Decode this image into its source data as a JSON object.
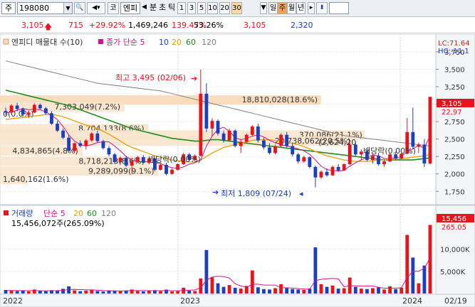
{
  "toolbar": {
    "market_label": "주",
    "code_value": "198080",
    "button_co": "코",
    "stock_name": "엔피",
    "label_split": "분",
    "label_tick": "초",
    "label_tik": "틱",
    "interval_buttons": [
      "1",
      "3",
      "5",
      "10",
      "20",
      "30"
    ],
    "interval_selected": "30",
    "label_day": "일",
    "label_week": "주",
    "label_month": "월",
    "label_year": "년"
  },
  "info_row": {
    "price": "3,105",
    "change": "715",
    "change_pct": "+29.92%",
    "volume": "1,469,246",
    "volume_ratio": "139.47%",
    "turnover_pct": "53.26%",
    "price_2": "3,105",
    "price_3": "2,320"
  },
  "price_panel": {
    "legend_volume_profile": "엔피디 매물대 수(10)",
    "legend_ma_label": "종가 단순 5",
    "ma_periods": [
      "10",
      "20",
      "60",
      "120"
    ],
    "ma_colors": {
      "5": "#d0128a",
      "10": "#1e44c8",
      "20": "#e8a000",
      "60": "#1c8f1c",
      "120": "#808080"
    },
    "lc_label": "LC:71.64",
    "hc_label": "HC:-11.1",
    "current_price_tag": "3,105",
    "right_tag_2": "22,97",
    "annot_high": "최고 3,495 (02/06)",
    "annot_low": "최저 1,809 (07/24)",
    "annot_dividend_1": "배당락(0.00%)",
    "annot_dividend_2": "배당락(0.00%)"
  },
  "volume_panel": {
    "legend_label": "거래량",
    "legend_ma": "단순 5",
    "ma_periods": [
      "20",
      "60",
      "120"
    ],
    "vol_readout": "15,456,072주(265.09%)",
    "right_tag_vol": "15,456",
    "right_tag_pct": "265.05"
  },
  "x_axis": {
    "labels": [
      "2022",
      "2023",
      "2024",
      "02/19"
    ]
  },
  "chart_data": {
    "type": "candlestick",
    "price_axis": {
      "ticks": [
        "3,750",
        "3,500",
        "3,250",
        "3,000",
        "2,750",
        "2,500",
        "2,250",
        "2,000",
        "1,750"
      ],
      "range": [
        1600,
        3780
      ]
    },
    "volume_axis": {
      "ticks": [
        "10,000K",
        "5,000K"
      ],
      "range": [
        0,
        16500
      ]
    },
    "volume_profile": [
      {
        "price": 3060,
        "label": "18,810,028(18.6%)",
        "value": 18810028
      },
      {
        "price": 2960,
        "label": "7,303,049(7.2%)",
        "value": 7303049
      },
      {
        "price": 2860,
        "label": "0(0.0%)",
        "value": 0
      },
      {
        "price": 2650,
        "label": "8,704,133(8.6%)",
        "value": 8704133
      },
      {
        "price": 2560,
        "label": "370,086(21.1%)",
        "value": 21370086
      },
      {
        "price": 2470,
        "label": "20,738,062(20.5%)",
        "value": 20738062
      },
      {
        "price": 2330,
        "label": "4,834,865(4.8%)",
        "value": 4834865
      },
      {
        "price": 2180,
        "label": "8,718,213(8.6%)",
        "value": 8718213
      },
      {
        "price": 2040,
        "label": "9,289,099(9.1%)",
        "value": 9289099
      },
      {
        "price": 1920,
        "label": "1,640,162(1.6%)",
        "value": 1640162
      }
    ],
    "annotation_extra": "(2,624,20",
    "candles": [
      [
        2900,
        2950,
        2840,
        2880
      ],
      [
        2880,
        3000,
        2860,
        2980
      ],
      [
        2980,
        3020,
        2900,
        2930
      ],
      [
        2930,
        2950,
        2820,
        2850
      ],
      [
        2850,
        2900,
        2800,
        2880
      ],
      [
        2880,
        3010,
        2870,
        2990
      ],
      [
        2990,
        3010,
        2920,
        2940
      ],
      [
        2940,
        2960,
        2850,
        2870
      ],
      [
        2870,
        2900,
        2700,
        2720
      ],
      [
        2720,
        2760,
        2600,
        2620
      ],
      [
        2620,
        2650,
        2500,
        2520
      ],
      [
        2520,
        2560,
        2300,
        2330
      ],
      [
        2330,
        2450,
        2320,
        2440
      ],
      [
        2440,
        2480,
        2380,
        2400
      ],
      [
        2400,
        2500,
        2350,
        2480
      ],
      [
        2480,
        2600,
        2460,
        2580
      ],
      [
        2580,
        2620,
        2450,
        2470
      ],
      [
        2470,
        2490,
        2350,
        2370
      ],
      [
        2370,
        2400,
        2250,
        2280
      ],
      [
        2280,
        2300,
        2150,
        2170
      ],
      [
        2170,
        2250,
        2150,
        2230
      ],
      [
        2230,
        2260,
        2100,
        2120
      ],
      [
        2120,
        2200,
        2000,
        2180
      ],
      [
        2180,
        2260,
        2160,
        2240
      ],
      [
        2240,
        2270,
        2150,
        2160
      ],
      [
        2160,
        2240,
        2140,
        2220
      ],
      [
        2220,
        2230,
        2040,
        2060
      ],
      [
        2060,
        2150,
        2050,
        2130
      ],
      [
        2130,
        2160,
        1980,
        2000
      ],
      [
        2000,
        2080,
        1990,
        2060
      ],
      [
        2060,
        2150,
        2050,
        2140
      ],
      [
        2140,
        2300,
        2130,
        2280
      ],
      [
        2280,
        2300,
        2180,
        2200
      ],
      [
        2200,
        2280,
        2190,
        2260
      ],
      [
        2260,
        3495,
        2250,
        3150
      ],
      [
        3150,
        3300,
        2600,
        2650
      ],
      [
        2650,
        2800,
        2550,
        2760
      ],
      [
        2760,
        2780,
        2550,
        2580
      ],
      [
        2580,
        2620,
        2450,
        2480
      ],
      [
        2480,
        2650,
        2470,
        2620
      ],
      [
        2620,
        2640,
        2380,
        2400
      ],
      [
        2400,
        2500,
        2300,
        2460
      ],
      [
        2460,
        2580,
        2440,
        2560
      ],
      [
        2560,
        2700,
        2540,
        2680
      ],
      [
        2680,
        2720,
        2450,
        2480
      ],
      [
        2480,
        2520,
        2350,
        2380
      ],
      [
        2380,
        2440,
        2280,
        2300
      ],
      [
        2300,
        2420,
        2280,
        2400
      ],
      [
        2400,
        2580,
        2390,
        2560
      ],
      [
        2560,
        2600,
        2380,
        2400
      ],
      [
        2400,
        2450,
        2250,
        2280
      ],
      [
        2280,
        2300,
        2150,
        2180
      ],
      [
        2180,
        2260,
        2160,
        2240
      ],
      [
        2240,
        2250,
        2080,
        2100
      ],
      [
        2100,
        2120,
        1809,
        1950
      ],
      [
        1950,
        2050,
        1930,
        2030
      ],
      [
        2030,
        2080,
        1960,
        1980
      ],
      [
        1980,
        2120,
        1970,
        2100
      ],
      [
        2100,
        2140,
        2030,
        2050
      ],
      [
        2050,
        2150,
        2040,
        2140
      ],
      [
        2140,
        2450,
        2130,
        2420
      ],
      [
        2420,
        2460,
        2260,
        2280
      ],
      [
        2280,
        2350,
        2200,
        2320
      ],
      [
        2320,
        2340,
        2180,
        2200
      ],
      [
        2200,
        2280,
        2150,
        2260
      ],
      [
        2260,
        2300,
        2120,
        2140
      ],
      [
        2140,
        2200,
        2100,
        2180
      ],
      [
        2180,
        2300,
        2170,
        2280
      ],
      [
        2280,
        2320,
        2200,
        2220
      ],
      [
        2220,
        2300,
        2210,
        2290
      ],
      [
        2290,
        2800,
        2280,
        2600
      ],
      [
        2600,
        2950,
        2350,
        2390
      ],
      [
        2390,
        2450,
        2300,
        2420
      ],
      [
        2420,
        2500,
        2100,
        2150
      ],
      [
        2150,
        3105,
        2140,
        3105
      ]
    ],
    "volumes": [
      800,
      620,
      540,
      700,
      480,
      900,
      600,
      520,
      760,
      680,
      1050,
      1600,
      700,
      520,
      650,
      900,
      580,
      460,
      720,
      600,
      540,
      680,
      900,
      560,
      480,
      620,
      760,
      520,
      880,
      470,
      520,
      1300,
      640,
      560,
      3400,
      9800,
      3600,
      2300,
      1500,
      1900,
      1300,
      1100,
      1700,
      5200,
      1400,
      1000,
      900,
      1200,
      2100,
      1200,
      1000,
      900,
      800,
      1100,
      10400,
      2100,
      1500,
      1800,
      1100,
      1200,
      3600,
      1500,
      1100,
      1000,
      1200,
      1400,
      900,
      1600,
      1000,
      1300,
      13200,
      8100,
      2300,
      6300,
      15456
    ],
    "ma5": [
      2870,
      2890,
      2910,
      2940,
      2920,
      2930,
      2920,
      2890,
      2840,
      2780,
      2680,
      2560,
      2470,
      2420,
      2400,
      2420,
      2450,
      2460,
      2460,
      2400,
      2330,
      2250,
      2200,
      2170,
      2180,
      2170,
      2160,
      2150,
      2110,
      2090,
      2080,
      2100,
      2140,
      2160,
      2200,
      2400,
      2540,
      2640,
      2670,
      2610,
      2520,
      2490,
      2510,
      2540,
      2560,
      2530,
      2480,
      2450,
      2420,
      2400,
      2380,
      2360,
      2330,
      2280,
      2200,
      2110,
      2060,
      2050,
      2040,
      2050,
      2110,
      2160,
      2200,
      2240,
      2270,
      2260,
      2220,
      2220,
      2230,
      2250,
      2320,
      2360,
      2410,
      2370,
      2550
    ],
    "ma20": [
      2780,
      2790,
      2800,
      2810,
      2820,
      2830,
      2840,
      2850,
      2850,
      2840,
      2820,
      2790,
      2760,
      2730,
      2700,
      2680,
      2650,
      2610,
      2570,
      2520,
      2470,
      2420,
      2380,
      2350,
      2320,
      2290,
      2260,
      2240,
      2220,
      2200,
      2190,
      2180,
      2170,
      2170,
      2200,
      2250,
      2300,
      2340,
      2380,
      2400,
      2420,
      2440,
      2460,
      2480,
      2490,
      2490,
      2490,
      2480,
      2470,
      2460,
      2440,
      2420,
      2390,
      2360,
      2320,
      2290,
      2260,
      2240,
      2220,
      2200,
      2190,
      2180,
      2180,
      2180,
      2190,
      2200,
      2200,
      2210,
      2210,
      2220,
      2230,
      2240,
      2250,
      2260,
      2280
    ],
    "ma60": [
      3200,
      3180,
      3160,
      3140,
      3120,
      3100,
      3080,
      3060,
      3040,
      3020,
      3000,
      2980,
      2950,
      2920,
      2890,
      2860,
      2830,
      2800,
      2770,
      2740,
      2710,
      2680,
      2650,
      2630,
      2610,
      2590,
      2570,
      2550,
      2530,
      2510,
      2500,
      2490,
      2480,
      2470,
      2470,
      2480,
      2490,
      2490,
      2480,
      2470,
      2460,
      2450,
      2440,
      2430,
      2420,
      2410,
      2400,
      2390,
      2380,
      2370,
      2360,
      2350,
      2340,
      2330,
      2320,
      2310,
      2300,
      2290,
      2280,
      2270,
      2260,
      2250,
      2240,
      2230,
      2220,
      2210,
      2200,
      2200,
      2200,
      2200,
      2200,
      2200,
      2210,
      2220,
      2230
    ],
    "ma120": [
      3620,
      3600,
      3580,
      3560,
      3540,
      3520,
      3500,
      3480,
      3460,
      3440,
      3420,
      3400,
      3380,
      3360,
      3340,
      3320,
      3300,
      3290,
      3280,
      3270,
      3260,
      3250,
      3240,
      3230,
      3220,
      3210,
      3200,
      3190,
      3170,
      3150,
      3130,
      3110,
      3090,
      3070,
      3050,
      3030,
      3010,
      2990,
      2970,
      2950,
      2930,
      2910,
      2890,
      2870,
      2850,
      2830,
      2810,
      2790,
      2770,
      2750,
      2730,
      2710,
      2690,
      2670,
      2650,
      2630,
      2610,
      2590,
      2570,
      2550,
      2540,
      2530,
      2520,
      2510,
      2500,
      2490,
      2480,
      2470,
      2460,
      2450,
      2440,
      2430,
      2420,
      2410,
      2400
    ],
    "vol_ma": [
      700,
      680,
      660,
      650,
      640,
      660,
      620,
      600,
      640,
      660,
      720,
      900,
      920,
      880,
      840,
      800,
      760,
      680,
      620,
      600,
      580,
      600,
      640,
      660,
      660,
      640,
      640,
      640,
      660,
      640,
      620,
      700,
      760,
      800,
      1300,
      3000,
      3700,
      3900,
      3800,
      3500,
      2200,
      1700,
      1400,
      2100,
      2100,
      1900,
      1900,
      1900,
      1300,
      1300,
      1200,
      1100,
      1000,
      1000,
      2900,
      3200,
      3300,
      3400,
      3300,
      1500,
      1800,
      1700,
      1700,
      1700,
      1700,
      1400,
      1200,
      1200,
      1200,
      1300,
      3600,
      5000,
      5000,
      5700,
      8000
    ]
  }
}
